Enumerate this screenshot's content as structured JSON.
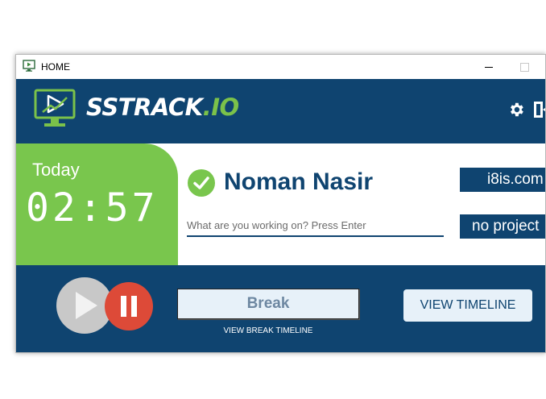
{
  "window": {
    "title": "HOME"
  },
  "header": {
    "brand_main": "SSTRACK",
    "brand_accent": ".IO",
    "settings_icon": "gear-icon",
    "exit_icon": "exit-icon"
  },
  "today": {
    "label": "Today",
    "time": "02:57"
  },
  "user": {
    "name": "Noman Nasir",
    "status_icon": "check-circle-icon"
  },
  "task": {
    "placeholder": "What are you working on? Press Enter",
    "value": ""
  },
  "badges": {
    "company": "i8is.com",
    "project": "no project"
  },
  "controls": {
    "break_label": "Break",
    "view_break_timeline": "VIEW BREAK TIMELINE",
    "view_timeline": "VIEW TIMELINE"
  },
  "colors": {
    "primary": "#0f4470",
    "green": "#79c64d",
    "red": "#dd4a38"
  }
}
